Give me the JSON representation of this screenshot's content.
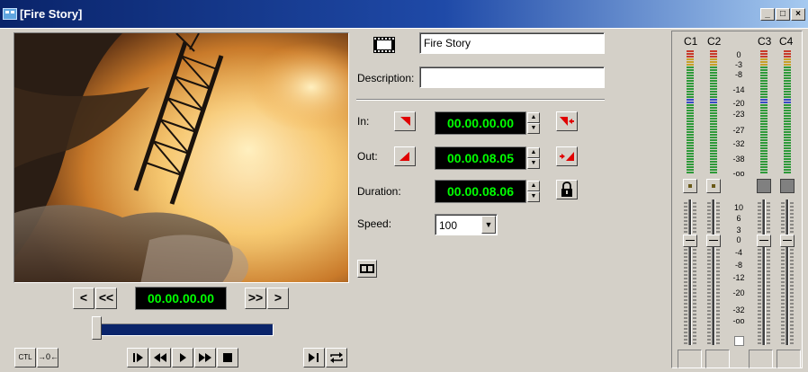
{
  "window": {
    "title": "[Fire Story]",
    "controls": [
      "_",
      "□",
      "×"
    ]
  },
  "clip": {
    "name": "Fire Story",
    "description_label": "Description:",
    "description_value": ""
  },
  "timecodes": {
    "in_label": "In:",
    "in_value": "00.00.00.00",
    "out_label": "Out:",
    "out_value": "00.00.08.05",
    "duration_label": "Duration:",
    "duration_value": "00.00.08.06",
    "current": "00.00.00.00"
  },
  "speed": {
    "label": "Speed:",
    "value": "100"
  },
  "transport": {
    "prev_label": "<",
    "rewind_label": "<<",
    "fastfwd_label": ">>",
    "next_label": ">",
    "ctl_label": "CTL",
    "zero_label": "→0←"
  },
  "scrub": {
    "position": 0.0
  },
  "audio": {
    "channels": [
      "C1",
      "C2",
      "C3",
      "C4"
    ],
    "meter_scale": [
      "0",
      "-3",
      "-8",
      "-14",
      "-20",
      "-23",
      "-27",
      "-32",
      "-38",
      "-oo"
    ],
    "fader_scale": [
      "10",
      "6",
      "3",
      "0",
      "-4",
      "-8",
      "-12",
      "-20",
      "-32",
      "-oo"
    ],
    "enabled": [
      true,
      true,
      false,
      false
    ]
  }
}
